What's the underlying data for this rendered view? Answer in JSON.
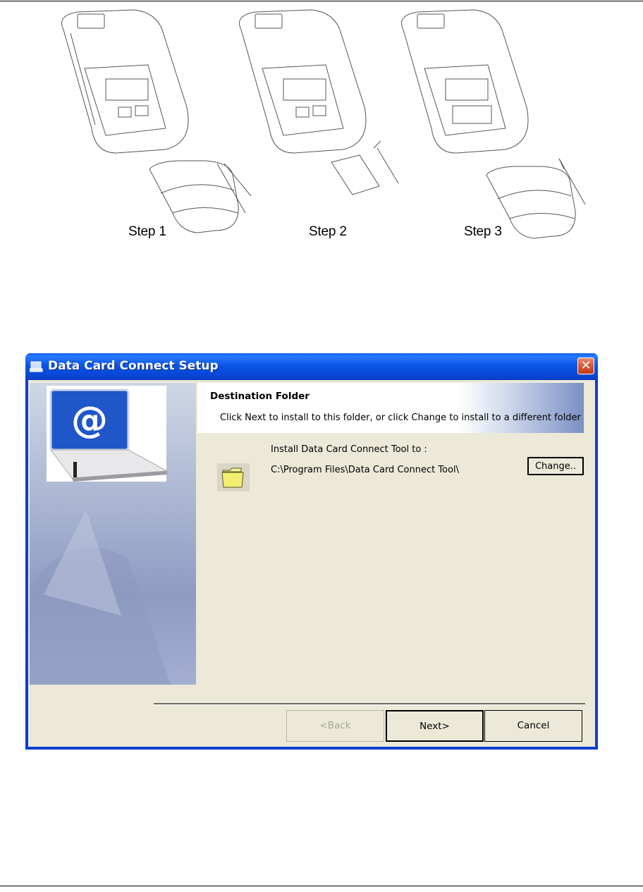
{
  "steps": {
    "labels": [
      "Step 1",
      "Step 2",
      "Step 3"
    ]
  },
  "dialog": {
    "title": "Data Card Connect Setup",
    "close_glyph": "✕",
    "header_title": "Destination Folder",
    "header_subtitle": "Click Next to install to this folder, or click Change to install to a different folder",
    "install_label": "Install Data Card Connect Tool to :",
    "install_path": "C:\\Program Files\\Data Card Connect Tool\\",
    "change_label": "Change..",
    "back_label": "<Back",
    "next_label": "Next>",
    "cancel_label": "Cancel",
    "back_enabled": false,
    "icons": {
      "title": "setup-app-icon",
      "folder": "folder-icon",
      "side": "laptop-at-sign-graphic"
    }
  }
}
